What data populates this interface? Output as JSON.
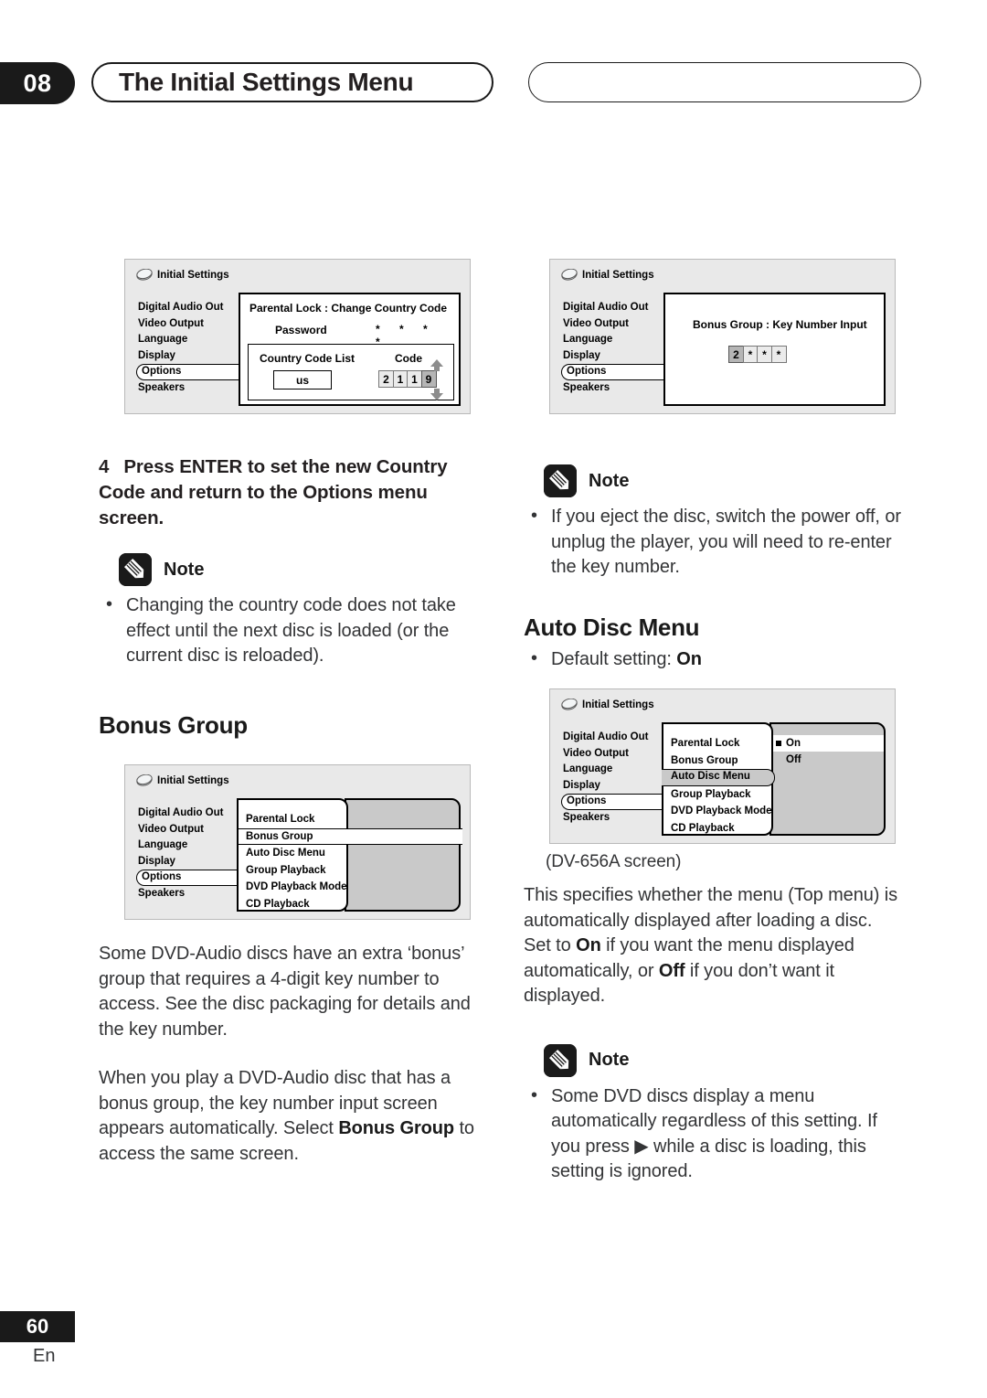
{
  "header": {
    "chapter_number": "08",
    "title": "The Initial Settings Menu"
  },
  "footer": {
    "page_number": "60",
    "language": "En"
  },
  "osd_common": {
    "window_title": "Initial Settings",
    "disc_icon": "disc-icon",
    "menu_items": [
      "Digital Audio Out",
      "Video Output",
      "Language",
      "Display",
      "Options",
      "Speakers"
    ],
    "selected_menu_item": "Options",
    "options_submenu": [
      "Parental  Lock",
      "Bonus Group",
      "Auto Disc Menu",
      "Group Playback",
      "DVD Playback Mode",
      "CD Playback"
    ]
  },
  "screen_country_code": {
    "panel_title": "Parental Lock : Change Country Code",
    "password_label": "Password",
    "password_value": "* * * *",
    "country_code_list_label": "Country Code List",
    "country_code_value": "us",
    "code_label": "Code",
    "code_digits": [
      "2",
      "1",
      "1",
      "9"
    ],
    "highlighted_digit_index": 3,
    "up_arrow_icon": "arrow-up-icon",
    "down_arrow_icon": "arrow-down-icon"
  },
  "screen_bonus_key": {
    "panel_title": "Bonus Group : Key Number Input",
    "key_digits": [
      "2",
      "*",
      "*",
      "*"
    ],
    "highlighted_digit_index": 0
  },
  "screen_bonus_group_menu": {
    "highlighted_submenu_item": "Bonus Group"
  },
  "screen_auto_disc_menu": {
    "highlighted_submenu_item": "Auto Disc Menu",
    "option_values": [
      "On",
      "Off"
    ],
    "selected_option": "On",
    "caption": "(DV-656A screen)"
  },
  "left_column": {
    "step4": {
      "number": "4",
      "text": "Press ENTER to set the new Country Code and return to the Options menu screen."
    },
    "note": {
      "icon": "pencil-note-icon",
      "label": "Note",
      "bullets": [
        "Changing the country code does not take effect until the next disc is loaded (or the current disc is reloaded)."
      ]
    },
    "bonus_group_heading": "Bonus Group",
    "paragraph_1": "Some DVD-Audio discs have an extra ‘bonus’ group that requires a 4-digit key number to access. See the disc packaging for details and the key number.",
    "paragraph_2_part1": "When you play a DVD-Audio disc that has a bonus group, the key number input screen appears automatically. Select ",
    "paragraph_2_bold": "Bonus Group",
    "paragraph_2_part2": " to access the same screen."
  },
  "right_column": {
    "note_top": {
      "icon": "pencil-note-icon",
      "label": "Note",
      "bullets": [
        "If you eject the disc, switch the power off, or unplug the player, you will need to re-enter the key number."
      ]
    },
    "auto_disc_menu_heading": "Auto Disc Menu",
    "default_setting_prefix": "Default setting: ",
    "default_setting_value": "On",
    "description_part1": "This specifies whether the menu (Top menu) is automatically displayed after loading a disc. Set to ",
    "description_bold1": "On",
    "description_part2": " if you want the menu displayed automatically, or ",
    "description_bold2": "Off",
    "description_part3": " if you don’t want it displayed.",
    "note_bottom": {
      "icon": "pencil-note-icon",
      "label": "Note",
      "bullet_part1": "Some DVD discs display a menu automatically regardless of this setting. If you press ",
      "bullet_play_icon": "▶",
      "bullet_part2": " while a disc is loading, this setting is ignored."
    }
  }
}
